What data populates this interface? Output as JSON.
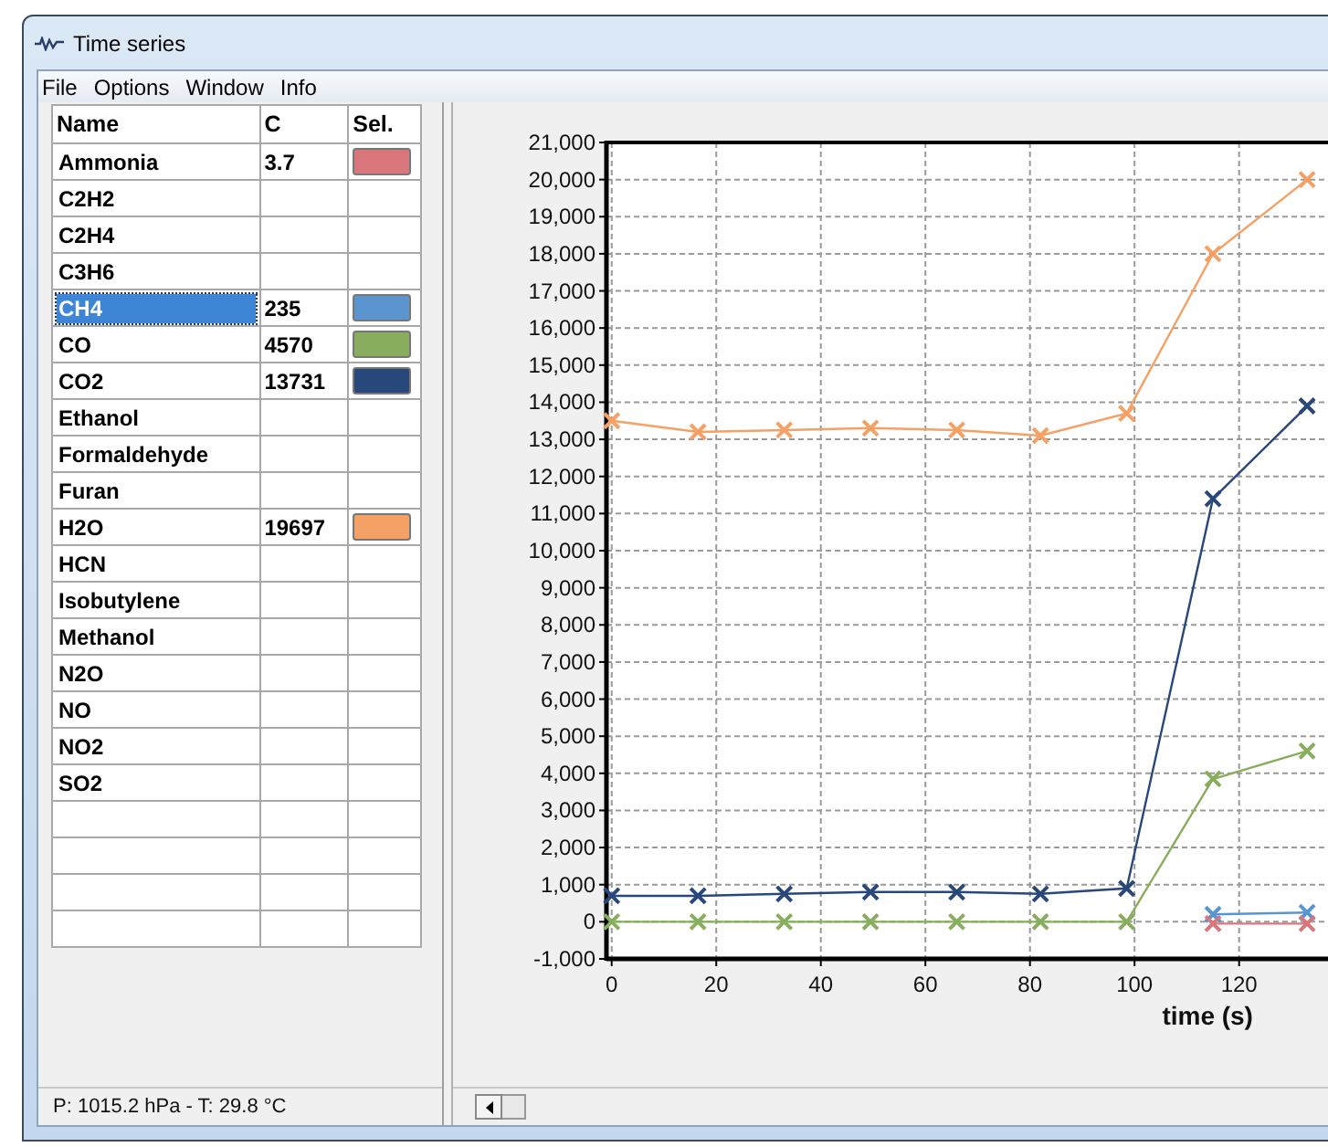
{
  "window": {
    "title": "Time series"
  },
  "menu": [
    "File",
    "Options",
    "Window",
    "Info"
  ],
  "table": {
    "columns": [
      "Name",
      "C",
      "Sel."
    ],
    "rows": [
      {
        "name": "Ammonia",
        "c": "3.7",
        "color": "#d9767c",
        "selected": false
      },
      {
        "name": "C2H2",
        "selected": false
      },
      {
        "name": "C2H4",
        "selected": false
      },
      {
        "name": "C3H6",
        "selected": false
      },
      {
        "name": "CH4",
        "c": "235",
        "color": "#5b95d0",
        "selected": true
      },
      {
        "name": "CO",
        "c": "4570",
        "color": "#88ad5c",
        "selected": false
      },
      {
        "name": "CO2",
        "c": "13731",
        "color": "#28477a",
        "selected": false
      },
      {
        "name": "Ethanol",
        "selected": false
      },
      {
        "name": "Formaldehyde",
        "selected": false
      },
      {
        "name": "Furan",
        "selected": false
      },
      {
        "name": "H2O",
        "c": "19697",
        "color": "#f5a064",
        "selected": false
      },
      {
        "name": "HCN",
        "selected": false
      },
      {
        "name": "Isobutylene",
        "selected": false
      },
      {
        "name": "Methanol",
        "selected": false
      },
      {
        "name": "N2O",
        "selected": false
      },
      {
        "name": "NO",
        "selected": false
      },
      {
        "name": "NO2",
        "selected": false
      },
      {
        "name": "SO2",
        "selected": false
      }
    ]
  },
  "status_bar": "P: 1015.2 hPa - T: 29.8 °C",
  "chart": {
    "chart_data": {
      "type": "line",
      "xlabel": "time (s)",
      "x": [
        0,
        16.5,
        33,
        49.5,
        66,
        82,
        98.5,
        115,
        133
      ],
      "series": [
        {
          "color": "#f5a064",
          "marker": "x",
          "values": [
            13500,
            13200,
            13250,
            13300,
            13250,
            13100,
            13700,
            18000,
            20000
          ]
        },
        {
          "color": "#28477a",
          "marker": "x",
          "values": [
            700,
            700,
            750,
            800,
            800,
            750,
            900,
            11400,
            13900
          ]
        },
        {
          "color": "#88ad5c",
          "marker": "x",
          "values": [
            0,
            0,
            0,
            0,
            0,
            0,
            0,
            3850,
            4600
          ]
        },
        {
          "color": "#5b95d0",
          "marker": "x",
          "values": [
            null,
            null,
            null,
            null,
            null,
            null,
            null,
            200,
            250
          ]
        },
        {
          "color": "#d9767c",
          "marker": "x",
          "values": [
            null,
            null,
            null,
            null,
            null,
            null,
            null,
            -50,
            -50
          ]
        }
      ],
      "grid": true,
      "xlim": [
        -1,
        137
      ],
      "ylim": [
        -1000,
        21000
      ],
      "xticks": [
        0,
        20,
        40,
        60,
        80,
        100,
        120
      ],
      "yticks": [
        {
          "value": -1000,
          "label": "-1,000"
        },
        {
          "value": 0,
          "label": "0"
        },
        {
          "value": 1000,
          "label": "1,000"
        },
        {
          "value": 2000,
          "label": "2,000"
        },
        {
          "value": 3000,
          "label": "3,000"
        },
        {
          "value": 4000,
          "label": "4,000"
        },
        {
          "value": 5000,
          "label": "5,000"
        },
        {
          "value": 6000,
          "label": "6,000"
        },
        {
          "value": 7000,
          "label": "7,000"
        },
        {
          "value": 8000,
          "label": "8,000"
        },
        {
          "value": 9000,
          "label": "9,000"
        },
        {
          "value": 10000,
          "label": "10,000"
        },
        {
          "value": 11000,
          "label": "11,000"
        },
        {
          "value": 12000,
          "label": "12,000"
        },
        {
          "value": 13000,
          "label": "13,000"
        },
        {
          "value": 14000,
          "label": "14,000"
        },
        {
          "value": 15000,
          "label": "15,000"
        },
        {
          "value": 16000,
          "label": "16,000"
        },
        {
          "value": 17000,
          "label": "17,000"
        },
        {
          "value": 18000,
          "label": "18,000"
        },
        {
          "value": 19000,
          "label": "19,000"
        },
        {
          "value": 20000,
          "label": "20,000"
        },
        {
          "value": 21000,
          "label": "21,000"
        }
      ]
    }
  }
}
